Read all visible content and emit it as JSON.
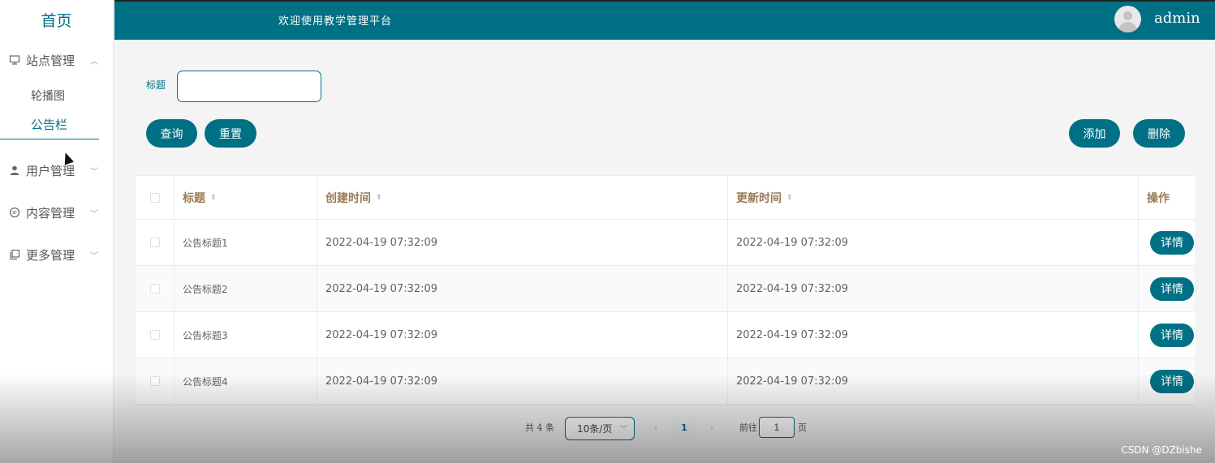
{
  "sidebar": {
    "home": "首页",
    "groups": [
      {
        "label": "站点管理",
        "icon": "monitor-icon",
        "expanded": true,
        "items": [
          "轮播图",
          "公告栏"
        ],
        "active_item": "公告栏"
      },
      {
        "label": "用户管理",
        "icon": "user-icon",
        "expanded": false
      },
      {
        "label": "内容管理",
        "icon": "chat-icon",
        "expanded": false
      },
      {
        "label": "更多管理",
        "icon": "copy-icon",
        "expanded": false
      }
    ]
  },
  "header": {
    "title": "欢迎使用教学管理平台",
    "user": "admin"
  },
  "search": {
    "label": "标题",
    "value": "",
    "query_button": "查询",
    "reset_button": "重置"
  },
  "actions": {
    "add_button": "添加",
    "delete_button": "删除"
  },
  "table": {
    "columns": [
      "标题",
      "创建时间",
      "更新时间",
      "操作"
    ],
    "rows": [
      {
        "title": "公告标题1",
        "created": "2022-04-19 07:32:09",
        "updated": "2022-04-19 07:32:09",
        "action": "详情"
      },
      {
        "title": "公告标题2",
        "created": "2022-04-19 07:32:09",
        "updated": "2022-04-19 07:32:09",
        "action": "详情"
      },
      {
        "title": "公告标题3",
        "created": "2022-04-19 07:32:09",
        "updated": "2022-04-19 07:32:09",
        "action": "详情"
      },
      {
        "title": "公告标题4",
        "created": "2022-04-19 07:32:09",
        "updated": "2022-04-19 07:32:09",
        "action": "详情"
      }
    ]
  },
  "pagination": {
    "total": "共 4 条",
    "page_size": "10条/页",
    "current_page": "1",
    "goto_prefix": "前往",
    "goto_value": "1",
    "goto_suffix": "页"
  },
  "watermark": "CSDN @DZbishe",
  "colors": {
    "primary": "#007085",
    "header_text": "#9a7b54"
  }
}
